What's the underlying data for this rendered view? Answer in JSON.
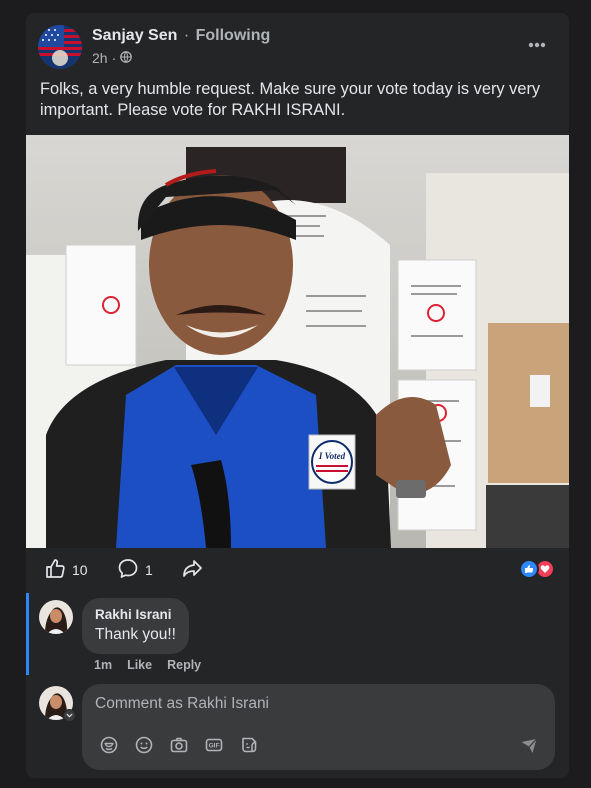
{
  "post": {
    "author": "Sanjay Sen",
    "separator": "·",
    "follow_status": "Following",
    "time": "2h",
    "audience_icon": "globe-icon",
    "text": "Folks,  a very humble request. Make sure your vote today is very very important. Please vote for RAKHI ISRANI."
  },
  "photo": {
    "sticker_text": "I Voted"
  },
  "actions": {
    "likes": "10",
    "comments": "1",
    "icons": [
      "like-icon",
      "comment-icon",
      "share-icon"
    ],
    "reactions": [
      "like-reaction-icon",
      "love-reaction-icon"
    ]
  },
  "comment": {
    "author": "Rakhi Israni",
    "text": "Thank you!!",
    "time": "1m",
    "like_label": "Like",
    "reply_label": "Reply"
  },
  "composer": {
    "placeholder": "Comment as Rakhi Israni",
    "tools": [
      "avatar-sticker-icon",
      "emoji-icon",
      "camera-icon",
      "gif-icon",
      "sticker-icon"
    ],
    "send_icon": "send-icon"
  },
  "colors": {
    "background": "#1c1c1e",
    "card": "#242526",
    "bubble": "#3a3b3c",
    "text_primary": "#e4e6eb",
    "text_secondary": "#b0b3b8",
    "accent_blue": "#2d88ff",
    "love_red": "#f33e58"
  }
}
